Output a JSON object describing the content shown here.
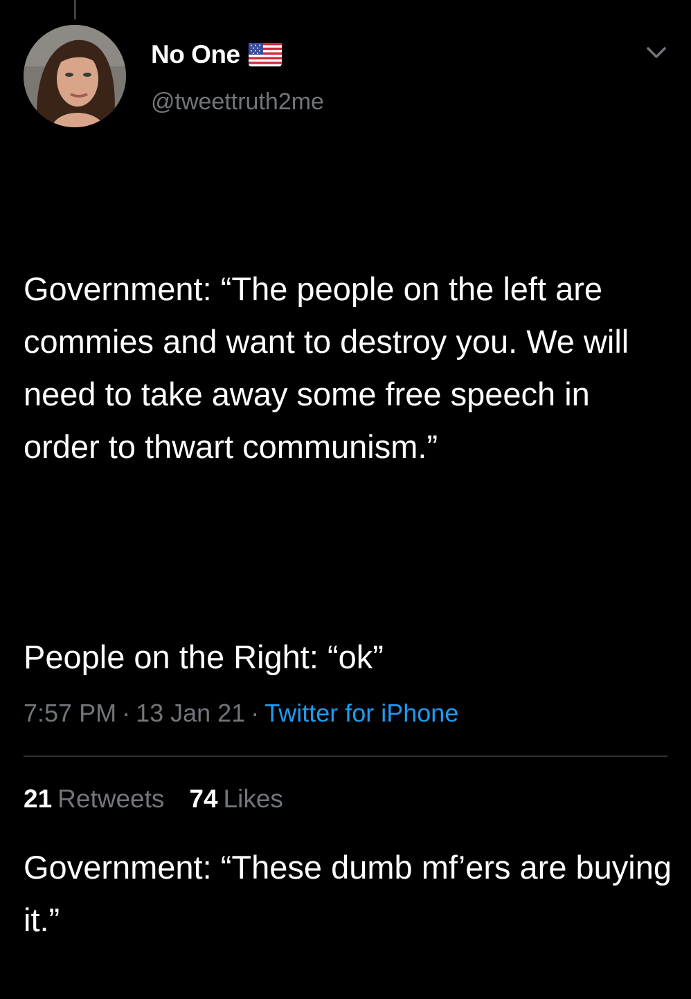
{
  "user": {
    "display_name": "No One",
    "handle": "@tweettruth2me",
    "flag_icon": "us-flag-icon"
  },
  "tweet": {
    "paragraphs": [
      "Government: “The people on the left are commies and want to destroy you. We will need to take away some free speech in order to thwart communism.”",
      "People on the Right: “ok”",
      "Government: “These dumb mf’ers are buying it.”"
    ],
    "time": "7:57 PM",
    "date": "13 Jan 21",
    "source": "Twitter for iPhone"
  },
  "stats": {
    "retweets_count": "21",
    "retweets_label": "Retweets",
    "likes_count": "74",
    "likes_label": "Likes"
  },
  "colors": {
    "background": "#000000",
    "text": "#ffffff",
    "secondary": "#71767b",
    "link": "#1d9bf0",
    "divider": "#2f3336"
  }
}
